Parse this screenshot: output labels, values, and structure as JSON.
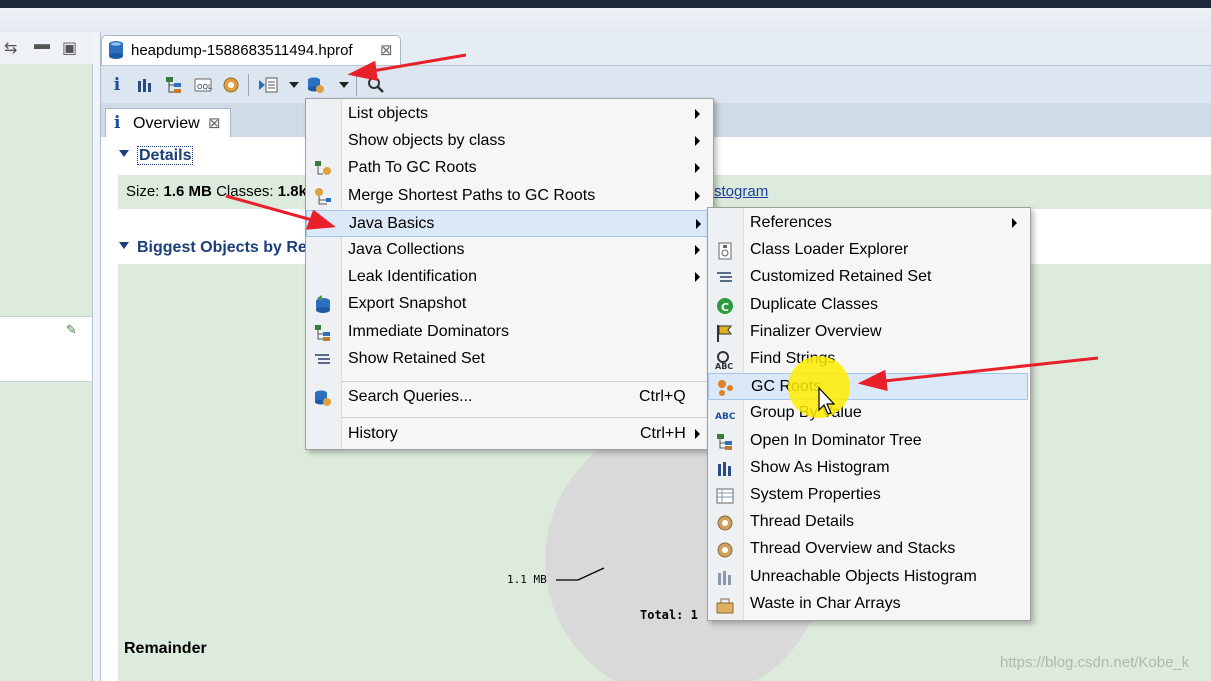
{
  "editor_tab": {
    "title": "heapdump-1588683511494.hprof"
  },
  "overview_tab": {
    "label": "Overview"
  },
  "details": {
    "header": "Details",
    "size_label": "Size:",
    "size_value": "1.6 MB",
    "classes_label": "Classes:",
    "classes_value": "1.8k",
    "histogram_link_partial": "stogram"
  },
  "biggest": {
    "header": "Biggest Objects by Re"
  },
  "pie": {
    "slice_label": "1.1 MB",
    "total_label": "Total: 1"
  },
  "remainder_label": "Remainder",
  "watermark": "https://blog.csdn.net/Kobe_k",
  "main_menu": {
    "items": [
      {
        "label": "List objects",
        "icon": "",
        "submenu": true
      },
      {
        "label": "Show objects by class",
        "icon": "",
        "submenu": true
      },
      {
        "label": "Path To GC Roots",
        "icon": "path-gc-roots-icon",
        "submenu": true
      },
      {
        "label": "Merge Shortest Paths to GC Roots",
        "icon": "merge-paths-icon",
        "submenu": true
      },
      {
        "label": "Java Basics",
        "icon": "",
        "submenu": true,
        "highlighted": true
      },
      {
        "label": "Java Collections",
        "icon": "",
        "submenu": true
      },
      {
        "label": "Leak Identification",
        "icon": "",
        "submenu": true
      },
      {
        "label": "Export Snapshot",
        "icon": "export-snapshot-icon",
        "submenu": false
      },
      {
        "label": "Immediate Dominators",
        "icon": "immediate-dominators-icon",
        "submenu": false
      },
      {
        "label": "Show Retained Set",
        "icon": "retained-set-icon",
        "submenu": false
      }
    ],
    "search_queries": {
      "label": "Search Queries...",
      "shortcut": "Ctrl+Q"
    },
    "history": {
      "label": "History",
      "shortcut": "Ctrl+H"
    }
  },
  "sub_menu": {
    "items": [
      {
        "label": "References",
        "icon": "",
        "submenu": true
      },
      {
        "label": "Class Loader Explorer",
        "icon": "class-loader-icon"
      },
      {
        "label": "Customized Retained Set",
        "icon": "retained-set-icon"
      },
      {
        "label": "Duplicate Classes",
        "icon": "duplicate-classes-icon"
      },
      {
        "label": "Finalizer Overview",
        "icon": "finalizer-icon"
      },
      {
        "label": "Find Strings",
        "icon": "find-strings-icon"
      },
      {
        "label": "GC Roots",
        "icon": "gc-roots-icon",
        "highlighted": true
      },
      {
        "label": "Group By Value",
        "icon": "group-by-value-icon"
      },
      {
        "label": "Open In Dominator Tree",
        "icon": "dominator-tree-icon"
      },
      {
        "label": "Show As Histogram",
        "icon": "histogram-icon"
      },
      {
        "label": "System Properties",
        "icon": "system-properties-icon"
      },
      {
        "label": "Thread Details",
        "icon": "thread-details-icon"
      },
      {
        "label": "Thread Overview and Stacks",
        "icon": "thread-overview-icon"
      },
      {
        "label": "Unreachable Objects Histogram",
        "icon": "unreachable-histogram-icon"
      },
      {
        "label": "Waste in Char Arrays",
        "icon": "char-arrays-icon"
      }
    ]
  },
  "colors": {
    "accent": "#1c3f7a",
    "highlight": "#dbe8f7",
    "annotation_arrow": "#e8202a",
    "cursor_glow": "#ffec00"
  }
}
